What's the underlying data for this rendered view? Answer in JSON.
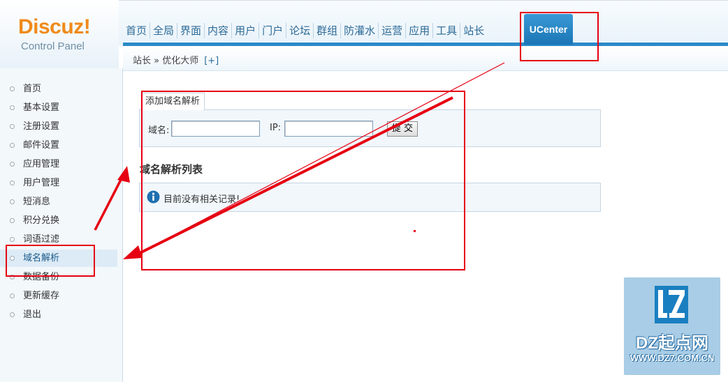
{
  "header": {
    "logo_word": "Discuz!",
    "logo_sub": "Control Panel",
    "nav": [
      "首页",
      "全局",
      "界面",
      "内容",
      "用户",
      "门户",
      "论坛",
      "群组",
      "防灌水",
      "运营",
      "应用",
      "工具",
      "站长"
    ],
    "nav_active": "UCenter"
  },
  "breadcrumb": {
    "path": "站长 » 优化大师",
    "add": "[+]"
  },
  "sidebar": {
    "items": [
      "首页",
      "基本设置",
      "注册设置",
      "邮件设置",
      "应用管理",
      "用户管理",
      "短消息",
      "积分兑换",
      "词语过滤",
      "域名解析",
      "数据备份",
      "更新缓存",
      "退出"
    ],
    "active_index": 9
  },
  "form": {
    "tab": "添加域名解析",
    "domain_label": "域名:",
    "ip_label": "IP:",
    "domain_value": "",
    "ip_value": "",
    "submit": "提 交"
  },
  "list": {
    "title": "域名解析列表",
    "empty_notice": "目前没有相关记录!"
  },
  "watermark": {
    "text": "DZ起点网",
    "url": "WWW.DZ7.COM.CN"
  },
  "colors": {
    "accent": "#2a8ac8",
    "annotation": "#e60012",
    "logo": "#f08a1a"
  }
}
